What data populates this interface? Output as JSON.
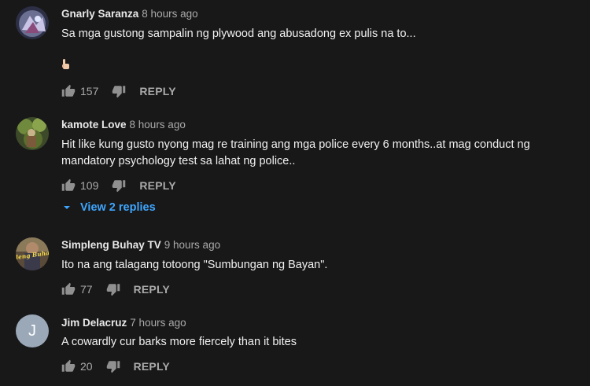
{
  "comments": [
    {
      "author": "Gnarly Saranza",
      "time": "8 hours ago",
      "text": "Sa mga gustong sampalin ng plywood ang abusadong ex pulis na to...",
      "emoji_icon": "pointing-down-emoji",
      "likes": "157",
      "reply_label": "REPLY"
    },
    {
      "author": "kamote Love",
      "time": "8 hours ago",
      "text": "Hit like kung gusto nyong mag re training  ang mga police every 6 months..at mag conduct ng mandatory psychology test sa lahat ng police..",
      "likes": "109",
      "reply_label": "REPLY",
      "replies_label": "View 2 replies"
    },
    {
      "author": "Simpleng Buhay TV",
      "time": "9 hours ago",
      "text": "Ito na ang talagang totoong \"Sumbungan ng Bayan\".",
      "avatar_text": "leng Buhay",
      "likes": "77",
      "reply_label": "REPLY"
    },
    {
      "author": "Jim Delacruz",
      "time": "7 hours ago",
      "text": "A cowardly cur barks more fiercely than it bites",
      "avatar_letter": "J",
      "likes": "20",
      "reply_label": "REPLY"
    }
  ],
  "colors": {
    "background": "#181818",
    "link_blue": "#3ea6ff",
    "secondary_text": "#aaaaaa",
    "letter_avatar": "#9aa8b8"
  }
}
